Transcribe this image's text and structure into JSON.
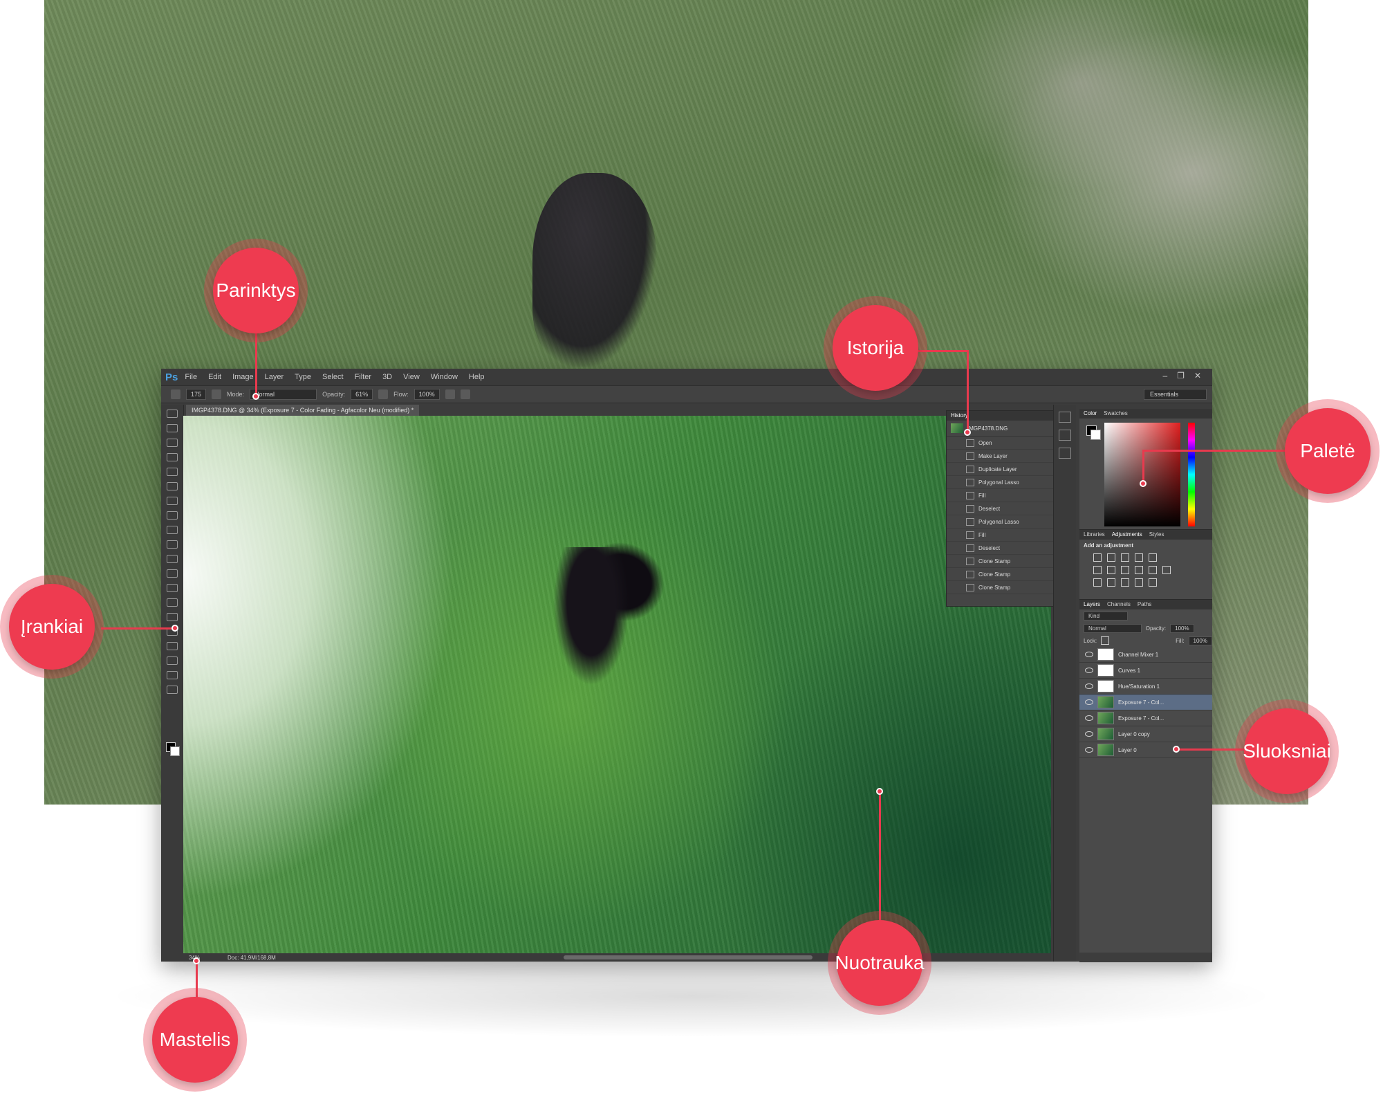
{
  "app": {
    "logo": "Ps",
    "menu": [
      "File",
      "Edit",
      "Image",
      "Layer",
      "Type",
      "Select",
      "Filter",
      "3D",
      "View",
      "Window",
      "Help"
    ],
    "window_controls": [
      "–",
      "❐",
      "✕"
    ]
  },
  "options_bar": {
    "brush_size": "175",
    "mode_label": "Mode:",
    "mode_value": "Normal",
    "opacity_label": "Opacity:",
    "opacity_value": "61%",
    "flow_label": "Flow:",
    "flow_value": "100%",
    "workspace": "Essentials"
  },
  "document": {
    "tab_title": "IMGP4378.DNG @ 34% (Exposure 7 - Color Fading - Agfacolor Neu (modified) *",
    "zoom": "34%",
    "doc_size": "Doc: 41,9M/168,8M"
  },
  "history": {
    "tab": "History",
    "snapshot": "IMGP4378.DNG",
    "items": [
      "Open",
      "Make Layer",
      "Duplicate Layer",
      "Polygonal Lasso",
      "Fill",
      "Deselect",
      "Polygonal Lasso",
      "Fill",
      "Deselect",
      "Clone Stamp",
      "Clone Stamp",
      "Clone Stamp"
    ]
  },
  "color_panel": {
    "tabs": [
      "Color",
      "Swatches"
    ]
  },
  "adjustments_panel": {
    "tabs": [
      "Libraries",
      "Adjustments",
      "Styles"
    ],
    "heading": "Add an adjustment"
  },
  "layers_panel": {
    "tabs": [
      "Layers",
      "Channels",
      "Paths"
    ],
    "kind_label": "Kind",
    "blend_mode": "Normal",
    "opacity_label": "Opacity:",
    "opacity_value": "100%",
    "lock_label": "Lock:",
    "fill_label": "Fill:",
    "fill_value": "100%",
    "layers": [
      "Channel Mixer 1",
      "Curves 1",
      "Hue/Saturation 1",
      "Exposure 7 - Col...",
      "Exposure 7 - Col...",
      "Layer 0 copy",
      "Layer 0"
    ]
  },
  "callouts": {
    "options": "Parinktys",
    "history": "Istorija",
    "palette": "Paletė",
    "tools": "Įrankiai",
    "layers": "Sluoksniai",
    "photo": "Nuotrauka",
    "zoom": "Mastelis"
  },
  "colors": {
    "callout_red": "#ee3b50",
    "selected_layer": "#5c6d86",
    "ps_blue": "#4aa0e0"
  }
}
